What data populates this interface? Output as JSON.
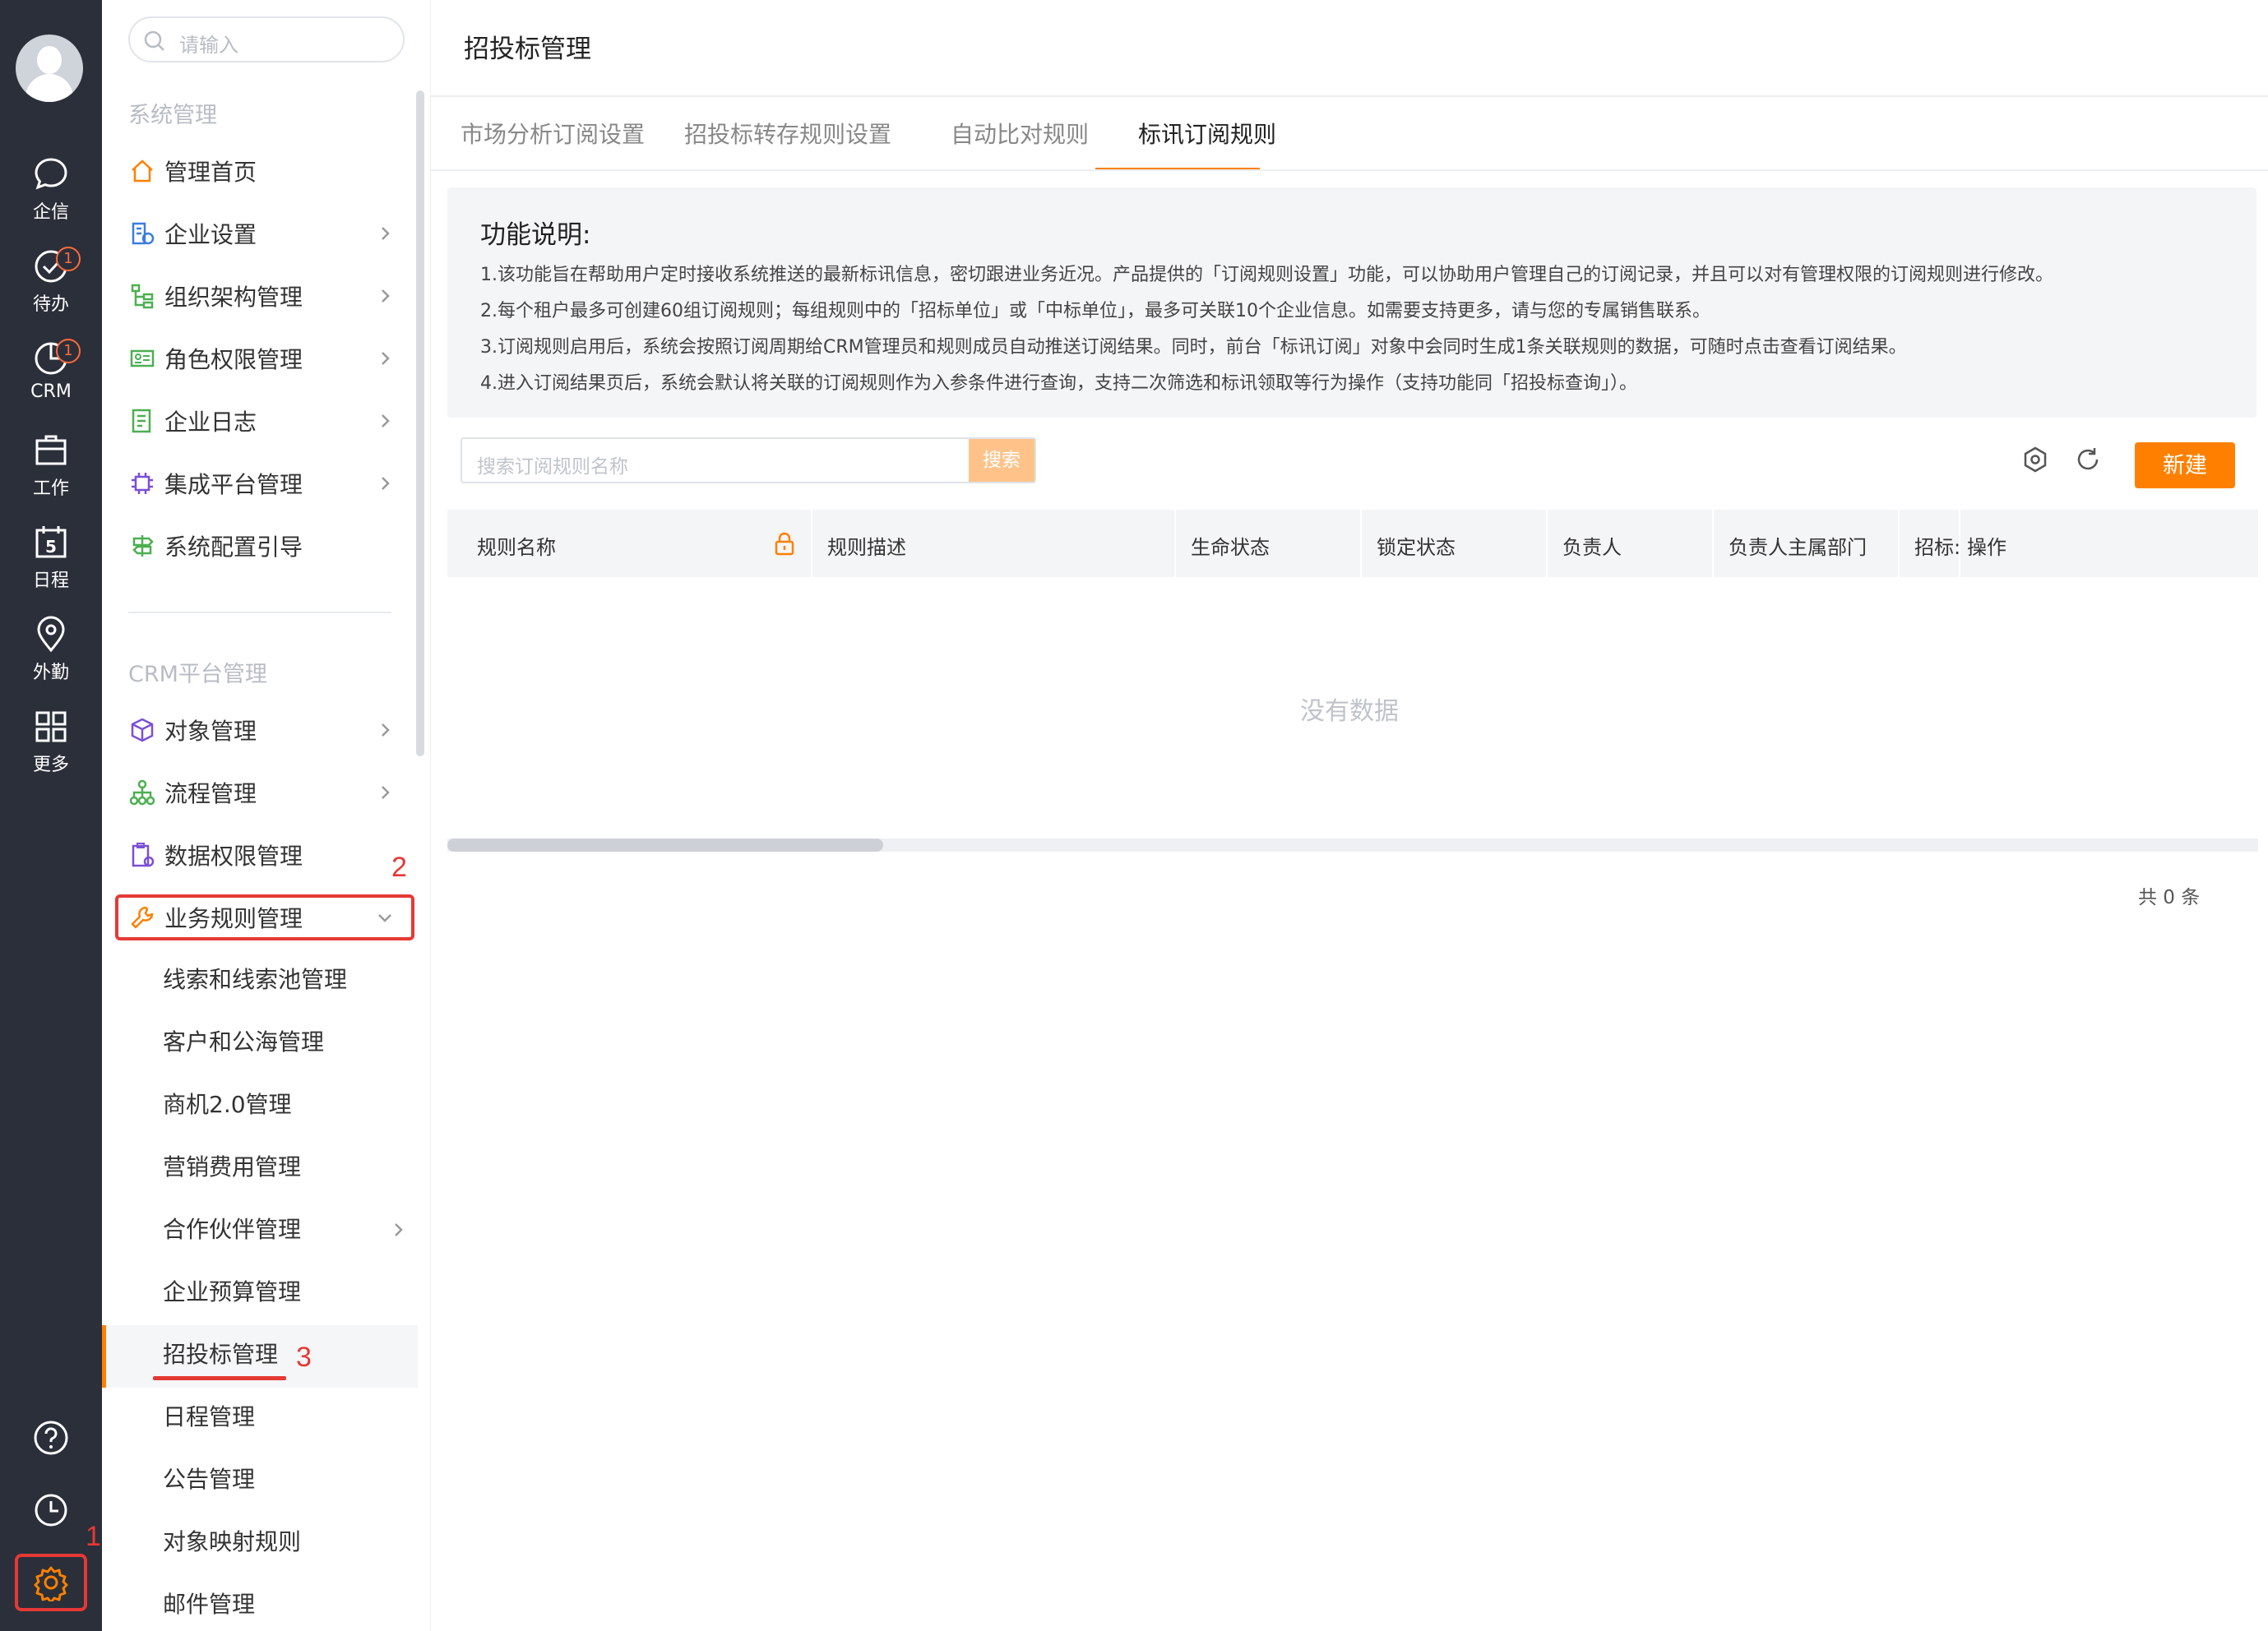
{
  "rail": {
    "items": [
      {
        "label": "企信",
        "icon": "chat-icon"
      },
      {
        "label": "待办",
        "icon": "check-circle-icon",
        "badge": "1"
      },
      {
        "label": "CRM",
        "icon": "pie-chart-icon",
        "badge": "1"
      },
      {
        "label": "工作",
        "icon": "briefcase-icon"
      },
      {
        "label": "日程",
        "icon": "calendar-icon",
        "day": "5"
      },
      {
        "label": "外勤",
        "icon": "location-icon"
      },
      {
        "label": "更多",
        "icon": "grid-icon"
      }
    ],
    "bottom_icons": [
      "help-icon",
      "clock-icon",
      "gear-icon"
    ]
  },
  "annotations": {
    "step1": "1",
    "step2": "2",
    "step3": "3"
  },
  "sidebar": {
    "search_placeholder": "请输入",
    "section1": "系统管理",
    "items1": [
      {
        "label": "管理首页"
      },
      {
        "label": "企业设置"
      },
      {
        "label": "组织架构管理"
      },
      {
        "label": "角色权限管理"
      },
      {
        "label": "企业日志"
      },
      {
        "label": "集成平台管理"
      },
      {
        "label": "系统配置引导"
      }
    ],
    "section2": "CRM平台管理",
    "items2": [
      {
        "label": "对象管理"
      },
      {
        "label": "流程管理"
      },
      {
        "label": "数据权限管理"
      },
      {
        "label": "业务规则管理"
      }
    ],
    "subitems": [
      "线索和线索池管理",
      "客户和公海管理",
      "商机2.0管理",
      "营销费用管理",
      "合作伙伴管理",
      "企业预算管理",
      "招投标管理",
      "日程管理",
      "公告管理",
      "对象映射规则",
      "邮件管理"
    ]
  },
  "main": {
    "title": "招投标管理",
    "tabs": [
      "市场分析订阅设置",
      "招投标转存规则设置",
      "自动比对规则",
      "标讯订阅规则"
    ],
    "info": {
      "heading": "功能说明:",
      "lines": [
        "1.该功能旨在帮助用户定时接收系统推送的最新标讯信息，密切跟进业务近况。产品提供的「订阅规则设置」功能，可以协助用户管理自己的订阅记录，并且可以对有管理权限的订阅规则进行修改。",
        "2.每个租户最多可创建60组订阅规则；每组规则中的「招标单位」或「中标单位」，最多可关联10个企业信息。如需要支持更多，请与您的专属销售联系。",
        "3.订阅规则启用后，系统会按照订阅周期给CRM管理员和规则成员自动推送订阅结果。同时，前台「标讯订阅」对象中会同时生成1条关联规则的数据，可随时点击查看订阅结果。",
        "4.进入订阅结果页后，系统会默认将关联的订阅规则作为入参条件进行查询，支持二次筛选和标讯领取等行为操作（支持功能同「招投标查询」）。"
      ]
    },
    "search_placeholder": "搜索订阅规则名称",
    "search_btn": "搜索",
    "new_btn": "新建",
    "columns": [
      "规则名称",
      "规则描述",
      "生命状态",
      "锁定状态",
      "负责人",
      "负责人主属部门",
      "招标:",
      "操作"
    ],
    "empty_text": "没有数据",
    "total": "共 0 条"
  }
}
